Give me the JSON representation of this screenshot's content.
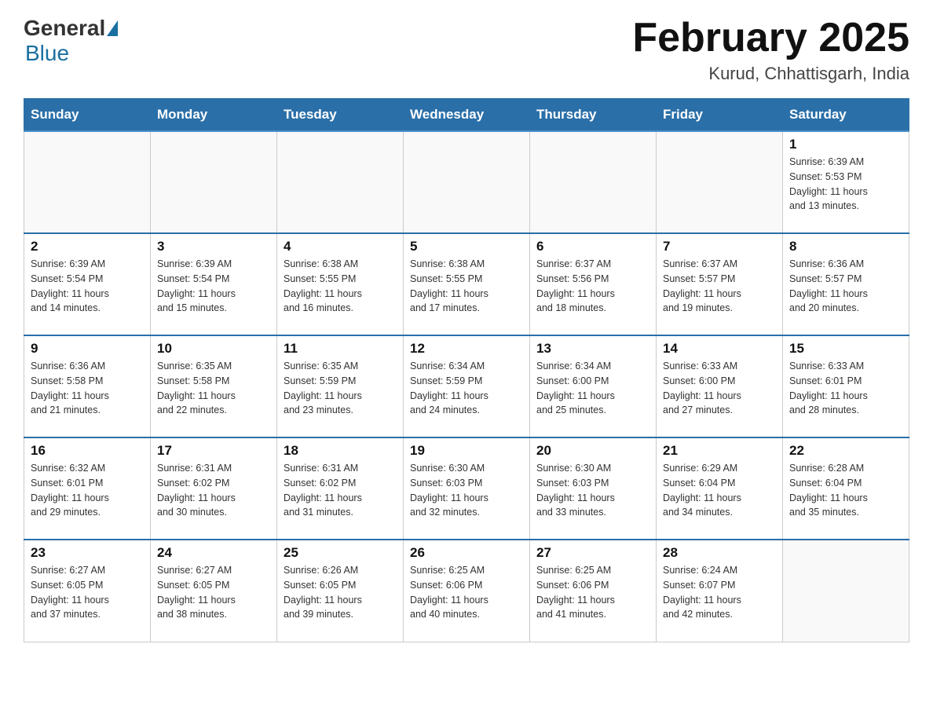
{
  "header": {
    "logo_general": "General",
    "logo_blue": "Blue",
    "month_title": "February 2025",
    "location": "Kurud, Chhattisgarh, India"
  },
  "days_of_week": [
    "Sunday",
    "Monday",
    "Tuesday",
    "Wednesday",
    "Thursday",
    "Friday",
    "Saturday"
  ],
  "weeks": [
    [
      {
        "day": "",
        "info": ""
      },
      {
        "day": "",
        "info": ""
      },
      {
        "day": "",
        "info": ""
      },
      {
        "day": "",
        "info": ""
      },
      {
        "day": "",
        "info": ""
      },
      {
        "day": "",
        "info": ""
      },
      {
        "day": "1",
        "info": "Sunrise: 6:39 AM\nSunset: 5:53 PM\nDaylight: 11 hours\nand 13 minutes."
      }
    ],
    [
      {
        "day": "2",
        "info": "Sunrise: 6:39 AM\nSunset: 5:54 PM\nDaylight: 11 hours\nand 14 minutes."
      },
      {
        "day": "3",
        "info": "Sunrise: 6:39 AM\nSunset: 5:54 PM\nDaylight: 11 hours\nand 15 minutes."
      },
      {
        "day": "4",
        "info": "Sunrise: 6:38 AM\nSunset: 5:55 PM\nDaylight: 11 hours\nand 16 minutes."
      },
      {
        "day": "5",
        "info": "Sunrise: 6:38 AM\nSunset: 5:55 PM\nDaylight: 11 hours\nand 17 minutes."
      },
      {
        "day": "6",
        "info": "Sunrise: 6:37 AM\nSunset: 5:56 PM\nDaylight: 11 hours\nand 18 minutes."
      },
      {
        "day": "7",
        "info": "Sunrise: 6:37 AM\nSunset: 5:57 PM\nDaylight: 11 hours\nand 19 minutes."
      },
      {
        "day": "8",
        "info": "Sunrise: 6:36 AM\nSunset: 5:57 PM\nDaylight: 11 hours\nand 20 minutes."
      }
    ],
    [
      {
        "day": "9",
        "info": "Sunrise: 6:36 AM\nSunset: 5:58 PM\nDaylight: 11 hours\nand 21 minutes."
      },
      {
        "day": "10",
        "info": "Sunrise: 6:35 AM\nSunset: 5:58 PM\nDaylight: 11 hours\nand 22 minutes."
      },
      {
        "day": "11",
        "info": "Sunrise: 6:35 AM\nSunset: 5:59 PM\nDaylight: 11 hours\nand 23 minutes."
      },
      {
        "day": "12",
        "info": "Sunrise: 6:34 AM\nSunset: 5:59 PM\nDaylight: 11 hours\nand 24 minutes."
      },
      {
        "day": "13",
        "info": "Sunrise: 6:34 AM\nSunset: 6:00 PM\nDaylight: 11 hours\nand 25 minutes."
      },
      {
        "day": "14",
        "info": "Sunrise: 6:33 AM\nSunset: 6:00 PM\nDaylight: 11 hours\nand 27 minutes."
      },
      {
        "day": "15",
        "info": "Sunrise: 6:33 AM\nSunset: 6:01 PM\nDaylight: 11 hours\nand 28 minutes."
      }
    ],
    [
      {
        "day": "16",
        "info": "Sunrise: 6:32 AM\nSunset: 6:01 PM\nDaylight: 11 hours\nand 29 minutes."
      },
      {
        "day": "17",
        "info": "Sunrise: 6:31 AM\nSunset: 6:02 PM\nDaylight: 11 hours\nand 30 minutes."
      },
      {
        "day": "18",
        "info": "Sunrise: 6:31 AM\nSunset: 6:02 PM\nDaylight: 11 hours\nand 31 minutes."
      },
      {
        "day": "19",
        "info": "Sunrise: 6:30 AM\nSunset: 6:03 PM\nDaylight: 11 hours\nand 32 minutes."
      },
      {
        "day": "20",
        "info": "Sunrise: 6:30 AM\nSunset: 6:03 PM\nDaylight: 11 hours\nand 33 minutes."
      },
      {
        "day": "21",
        "info": "Sunrise: 6:29 AM\nSunset: 6:04 PM\nDaylight: 11 hours\nand 34 minutes."
      },
      {
        "day": "22",
        "info": "Sunrise: 6:28 AM\nSunset: 6:04 PM\nDaylight: 11 hours\nand 35 minutes."
      }
    ],
    [
      {
        "day": "23",
        "info": "Sunrise: 6:27 AM\nSunset: 6:05 PM\nDaylight: 11 hours\nand 37 minutes."
      },
      {
        "day": "24",
        "info": "Sunrise: 6:27 AM\nSunset: 6:05 PM\nDaylight: 11 hours\nand 38 minutes."
      },
      {
        "day": "25",
        "info": "Sunrise: 6:26 AM\nSunset: 6:05 PM\nDaylight: 11 hours\nand 39 minutes."
      },
      {
        "day": "26",
        "info": "Sunrise: 6:25 AM\nSunset: 6:06 PM\nDaylight: 11 hours\nand 40 minutes."
      },
      {
        "day": "27",
        "info": "Sunrise: 6:25 AM\nSunset: 6:06 PM\nDaylight: 11 hours\nand 41 minutes."
      },
      {
        "day": "28",
        "info": "Sunrise: 6:24 AM\nSunset: 6:07 PM\nDaylight: 11 hours\nand 42 minutes."
      },
      {
        "day": "",
        "info": ""
      }
    ]
  ]
}
